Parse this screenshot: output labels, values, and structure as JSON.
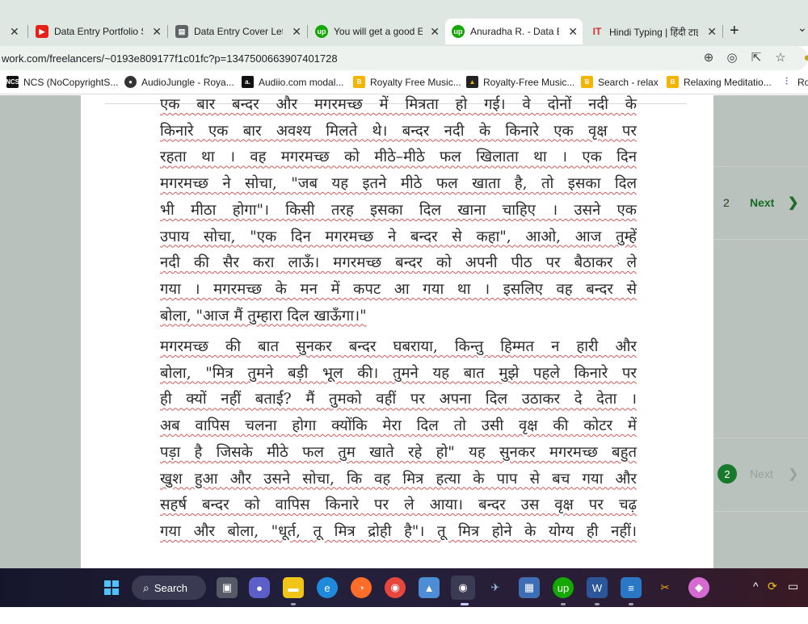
{
  "tabs": [
    {
      "title": "Data Entry Portfolio Sa",
      "icon": "youtube-icon",
      "color": "#e62117",
      "active": false
    },
    {
      "title": "Data Entry Cover Lette",
      "icon": "document-icon",
      "color": "#1a73e8",
      "active": false
    },
    {
      "title": "You will get a good Er",
      "icon": "upwork-icon",
      "color": "#14a800",
      "active": false
    },
    {
      "title": "Anuradha R. - Data En",
      "icon": "upwork-icon",
      "color": "#14a800",
      "active": true
    },
    {
      "title": "Hindi Typing | हिंदी टाइ",
      "icon": "it-logo-icon",
      "color": "#d32f2f",
      "active": false
    }
  ],
  "address": {
    "url": "work.com/freelancers/~0193e809177f1c01fc?p=1347500663907401728"
  },
  "bookmarks": [
    {
      "label": "NCS (NoCopyrightS...",
      "icon": "ncs-icon",
      "color": "#111111"
    },
    {
      "label": "AudioJungle - Roya...",
      "icon": "audiojungle-icon",
      "color": "#333333"
    },
    {
      "label": "Audiio.com modal...",
      "icon": "audiio-icon",
      "color": "#111111"
    },
    {
      "label": "Royalty Free Music...",
      "icon": "bookmark-b-icon",
      "color": "#f4b400"
    },
    {
      "label": "Royalty-Free Music...",
      "icon": "triangle-logo-icon",
      "color": "#222222"
    },
    {
      "label": "Search - relax",
      "icon": "bookmark-b-icon",
      "color": "#f4b400"
    },
    {
      "label": "Relaxing Meditatio...",
      "icon": "bookmark-b-icon",
      "color": "#f4b400"
    },
    {
      "label": "Ro",
      "icon": "soundwave-icon",
      "color": "#6a4fb3"
    }
  ],
  "document": {
    "paragraph1": [
      "एक बार बन्दर और मगरमच्छ में मित्रता हो गई। वे दोनों नदी के",
      "किनारे एक बार अवश्य मिलते थे। बन्दर नदी के किनारे एक वृक्ष पर",
      "रहता था । वह मगरमच्छ को मीठे–मीठे फल खिलाता था । एक दिन",
      "मगरमच्छ ने सोचा, \"जब यह इतने मीठे फल खाता है, तो इसका दिल",
      "भी मीठा होगा\"। किसी तरह इसका दिल खाना चाहिए । उसने एक",
      "उपाय सोचा, \"एक दिन मगरमच्छ ने बन्दर से कहा\", आओ, आज तुम्हें",
      "नदी की सैर करा लाऊँ। मगरमच्छ बन्दर को अपनी पीठ पर बैठाकर ले",
      "गया । मगरमच्छ के मन में कपट आ गया था । इसलिए वह बन्दर से",
      "बोला, \"आज मैं तुम्हारा दिल खाऊँगा।\""
    ],
    "paragraph2": [
      "मगरमच्छ की बात सुनकर बन्दर घबराया, किन्तु हिम्मत न हारी और",
      "बोला, \"मित्र तुमने बड़ी भूल की। तुमने यह बात मुझे पहले किनारे पर",
      "ही क्यों नहीं बताई? मैं तुमको वहीं पर अपना दिल उठाकर दे देता ।",
      "अब वापिस चलना होगा क्योंकि मेरा दिल तो उसी वृक्ष की कोटर में",
      "पड़ा है जिसके मीठे फल तुम खाते रहे हो\" यह सुनकर मगरमच्छ बहुत",
      "खुश हुआ और उसने सोचा, कि वह मित्र हत्या के पाप से बच गया और",
      "सहर्ष बन्दर को वापिस किनारे पर ले आया। बन्दर उस वृक्ष पर चढ़",
      "गया और बोला, \"धूर्त, तू मित्र द्रोही है\"। तू मित्र होने के योग्य ही नहीं।"
    ]
  },
  "pagination_top": {
    "page": "2",
    "next_label": "Next"
  },
  "pagination_bottom": {
    "page": "2",
    "next_label": "Next"
  },
  "taskbar": {
    "search_label": "Search",
    "apps": [
      "windows-start-icon",
      "task-view-icon",
      "chat-icon",
      "file-explorer-icon",
      "edge-icon",
      "firefox-icon",
      "chrome-icon",
      "photos-icon",
      "chrome-profile-icon",
      "bird-app-icon",
      "calculator-icon",
      "upwork-app-icon",
      "word-icon",
      "notepad-icon",
      "snipping-icon",
      "paint-icon"
    ]
  }
}
